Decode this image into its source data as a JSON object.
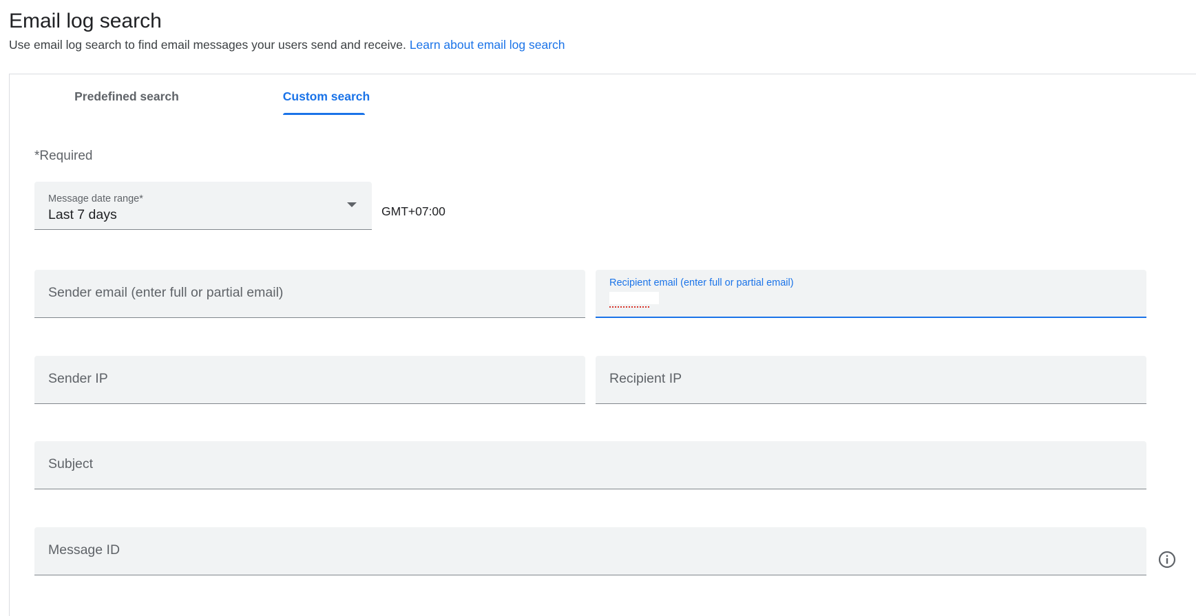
{
  "header": {
    "title": "Email log search",
    "description": "Use email log search to find email messages your users send and receive.",
    "learn_link": "Learn about email log search"
  },
  "tabs": [
    {
      "label": "Predefined search",
      "active": false
    },
    {
      "label": "Custom search",
      "active": true
    }
  ],
  "form": {
    "required_note": "*Required",
    "date_range": {
      "label": "Message date range*",
      "value": "Last 7 days"
    },
    "timezone": "GMT+07:00",
    "sender_email": {
      "placeholder": "Sender email (enter full or partial email)"
    },
    "recipient_email": {
      "label": "Recipient email (enter full or partial email)",
      "value": ""
    },
    "sender_ip": {
      "placeholder": "Sender IP"
    },
    "recipient_ip": {
      "placeholder": "Recipient IP"
    },
    "subject": {
      "placeholder": "Subject"
    },
    "message_id": {
      "placeholder": "Message ID"
    }
  },
  "icons": {
    "dropdown": "arrow-drop-down-icon",
    "info": "info-outline-icon"
  },
  "colors": {
    "accent": "#1a73e8",
    "field_bg": "#f1f3f4",
    "error_underline": "#d93025"
  }
}
